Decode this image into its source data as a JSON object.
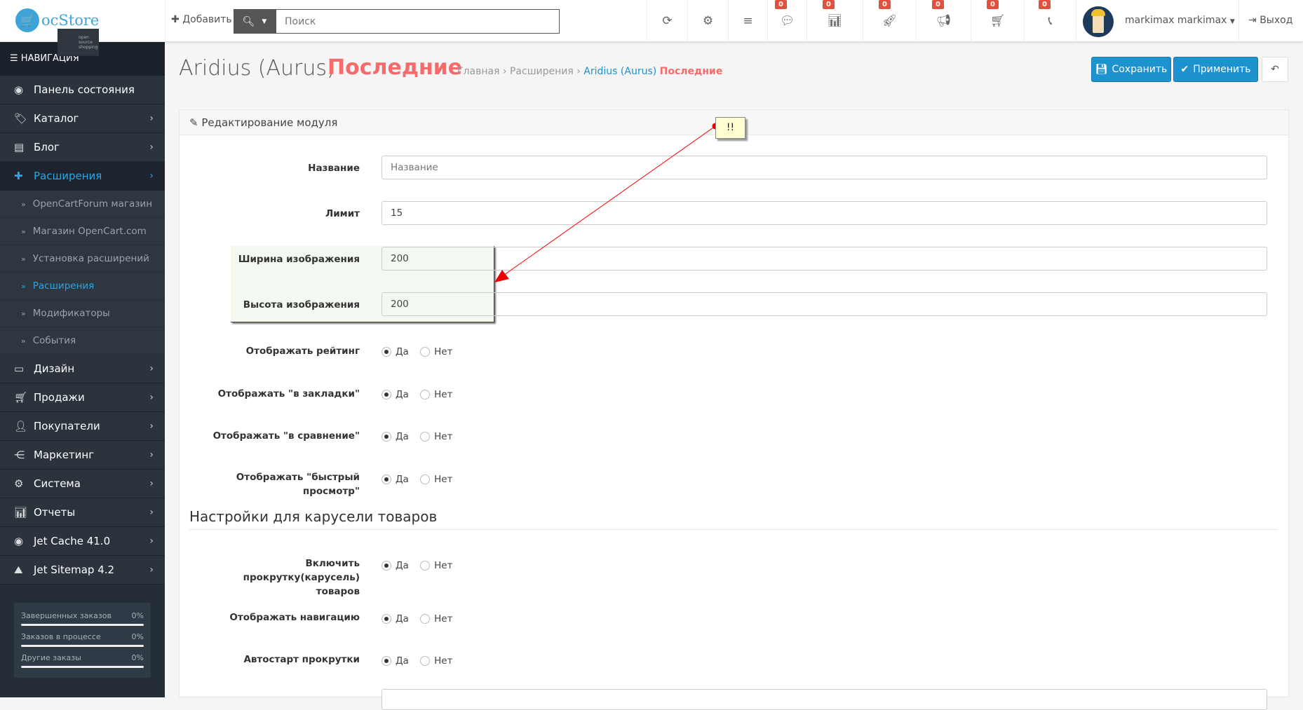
{
  "header": {
    "logo_text": "ocStore",
    "logo_sub": "open source shopping",
    "add_label": "Добавить",
    "search_placeholder": "Поиск",
    "badges": [
      "0",
      "0",
      "0",
      "0",
      "0",
      "0"
    ],
    "user": "markimax markimax",
    "logout": "Выход"
  },
  "sidebar": {
    "nav_title": "НАВИГАЦИЯ",
    "items": [
      {
        "label": "Панель состояния"
      },
      {
        "label": "Каталог"
      },
      {
        "label": "Блог"
      },
      {
        "label": "Расширения"
      },
      {
        "label": "Дизайн"
      },
      {
        "label": "Продажи"
      },
      {
        "label": "Покупатели"
      },
      {
        "label": "Маркетинг"
      },
      {
        "label": "Система"
      },
      {
        "label": "Отчеты"
      },
      {
        "label": "Jet Cache 41.0"
      },
      {
        "label": "Jet Sitemap 4.2"
      }
    ],
    "subitems": [
      {
        "label": "OpenCartForum магазин"
      },
      {
        "label": "Магазин OpenCart.com"
      },
      {
        "label": "Установка расширений"
      },
      {
        "label": "Расширения"
      },
      {
        "label": "Модификаторы"
      },
      {
        "label": "События"
      }
    ],
    "stats": [
      {
        "label": "Завершенных заказов",
        "value": "0%",
        "progress": 0
      },
      {
        "label": "Заказов в процессе",
        "value": "0%",
        "progress": 0
      },
      {
        "label": "Другие заказы",
        "value": "0%",
        "progress": 0
      }
    ]
  },
  "page": {
    "title": "Aridius (Aurus)",
    "title_accent": "Последние",
    "breadcrumb": [
      "Главная",
      "Расширения",
      "Aridius (Aurus)",
      "Последние"
    ],
    "save": "Сохранить",
    "apply": "Применить"
  },
  "panel": {
    "heading": "Редактирование модуля",
    "name_label": "Название",
    "name_placeholder": "Название",
    "limit_label": "Лимит",
    "limit_value": "15",
    "width_label": "Ширина изображения",
    "width_value": "200",
    "height_label": "Высота изображения",
    "height_value": "200",
    "yes": "Да",
    "no": "Нет",
    "rating_label": "Отображать рейтинг",
    "wishlist_label": "Отображать \"в закладки\"",
    "compare_label": "Отображать \"в сравнение\"",
    "quickview_label": "Отображать \"быстрый просмотр\"",
    "carousel_heading": "Настройки для карусели товаров",
    "carousel_label": "Включить прокрутку(карусель) товаров",
    "nav_label": "Отображать навигацию",
    "autoplay_label": "Автостарт прокрутки"
  },
  "annotation": {
    "text": "!!",
    "color": "#ff0000"
  }
}
